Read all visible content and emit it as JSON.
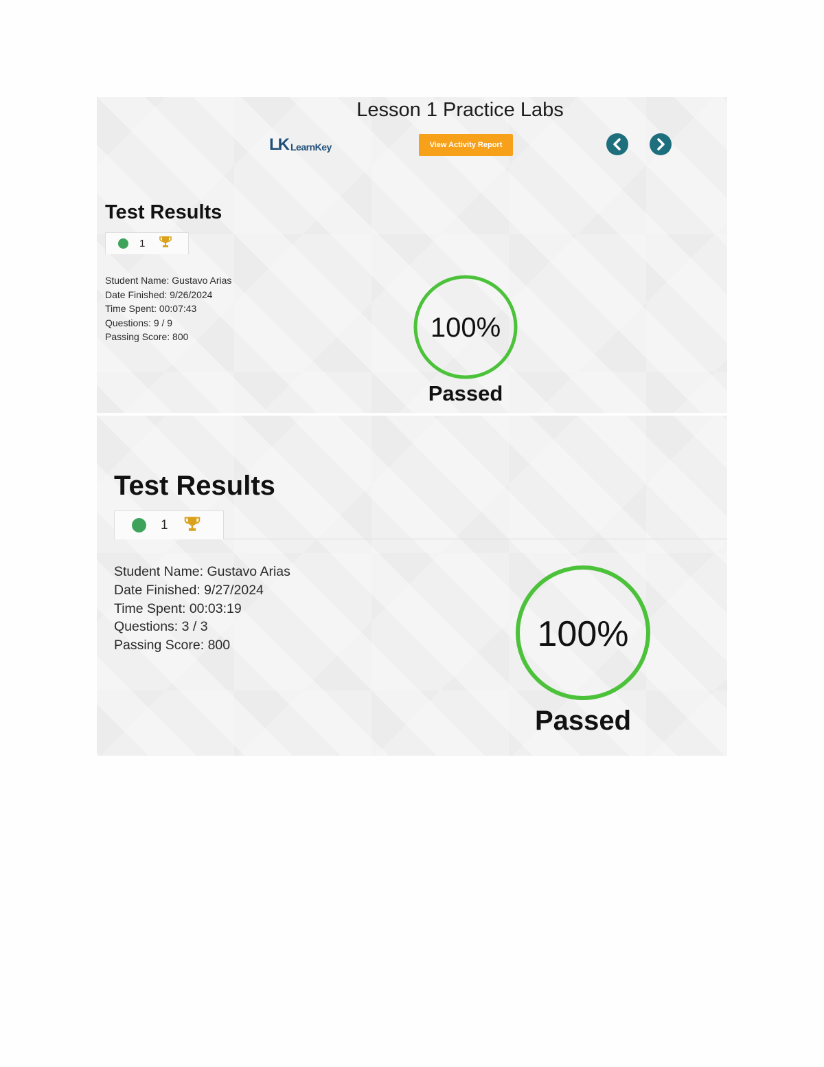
{
  "header": {
    "title": "Lesson 1 Practice Labs",
    "logo_mark": "LK",
    "logo_text": "LearnKey",
    "report_button_label": "View Activity Report",
    "prev_icon": "chevron-left-icon",
    "next_icon": "chevron-right-icon",
    "nav_color": "#1e6f7e",
    "button_color": "#f7a11a"
  },
  "results": [
    {
      "title": "Test Results",
      "attempt_count": "1",
      "student_name": "Student Name: Gustavo Arias",
      "date_finished": "Date Finished: 9/26/2024",
      "time_spent": "Time Spent: 00:07:43",
      "questions": "Questions: 9 / 9",
      "passing_score": "Passing Score: 800",
      "score": "100%",
      "score_fraction": 1.0,
      "status": "Passed"
    },
    {
      "title": "Test Results",
      "attempt_count": "1",
      "student_name": "Student Name: Gustavo Arias",
      "date_finished": "Date Finished: 9/27/2024",
      "time_spent": "Time Spent: 00:03:19",
      "questions": "Questions: 3 / 3",
      "passing_score": "Passing Score: 800",
      "score": "100%",
      "score_fraction": 1.0,
      "status": "Passed"
    }
  ],
  "colors": {
    "pass_green": "#4cc23a",
    "dot_green": "#3ea35a",
    "trophy_gold": "#d9a11c"
  }
}
